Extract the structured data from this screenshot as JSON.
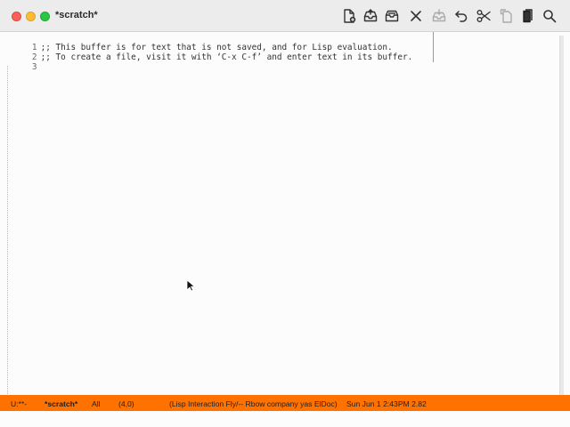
{
  "window": {
    "title": "*scratch*"
  },
  "toolbar": {
    "items": [
      {
        "icon": "new-file-icon",
        "label": "New file"
      },
      {
        "icon": "open-icon",
        "label": "Open"
      },
      {
        "icon": "dired-icon",
        "label": "Dired"
      },
      {
        "icon": "close-icon",
        "label": "Close"
      },
      {
        "icon": "save-icon",
        "label": "Save",
        "disabled": true
      },
      {
        "icon": "undo-icon",
        "label": "Undo"
      },
      {
        "icon": "cut-icon",
        "label": "Cut"
      },
      {
        "icon": "copy-icon",
        "label": "Copy",
        "disabled": true
      },
      {
        "icon": "paste-icon",
        "label": "Paste"
      },
      {
        "icon": "search-icon",
        "label": "Search"
      }
    ]
  },
  "buffer": {
    "lines": [
      {
        "number": "1",
        "text": ";; This buffer is for text that is not saved, and for Lisp evaluation."
      },
      {
        "number": "2",
        "text": ";; To create a file, visit it with ‘C-x C-f’ and enter text in its buffer."
      },
      {
        "number": "3",
        "text": ""
      }
    ]
  },
  "modeline": {
    "status": "U:**-",
    "buffer_name": "*scratch*",
    "position": "All",
    "line_col": "(4,0)",
    "modes": "(Lisp Interaction Fly/-- Rbow company yas ElDoc)",
    "datetime": "Sun Jun  1 2:43PM 2.82",
    "background": "#ff7200"
  },
  "echo_area": {
    "text": ""
  }
}
